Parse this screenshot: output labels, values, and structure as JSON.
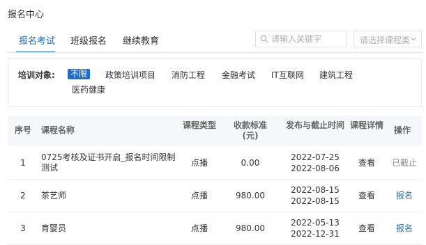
{
  "page_title": "报名中心",
  "tabs": [
    {
      "label": "报名考试",
      "active": true
    },
    {
      "label": "班级报名",
      "active": false
    },
    {
      "label": "继续教育",
      "active": false
    }
  ],
  "search": {
    "placeholder": "请输入关键字"
  },
  "course_type_select": {
    "placeholder": "请选择课程类"
  },
  "filter": {
    "label": "培训对象:",
    "options": [
      "不限",
      "政策培训项目",
      "消防工程",
      "金融考试",
      "IT互联网",
      "建筑工程",
      "医药健康"
    ],
    "selected": "不限"
  },
  "table": {
    "headers": {
      "index": "序号",
      "name": "课程名称",
      "type": "课程类型",
      "fee": "收款标准(元)",
      "dates": "发布与截止时间",
      "detail": "课程详情",
      "action": "操作"
    },
    "rows": [
      {
        "index": "1",
        "name": "0725考核及证书开启_报名时间限制测试",
        "type": "点播",
        "fee": "0.00",
        "publish": "2022-07-25",
        "deadline": "2022-08-06",
        "detail": "查看",
        "action": "已截止",
        "action_enabled": false
      },
      {
        "index": "2",
        "name": "茶艺师",
        "type": "点播",
        "fee": "980.00",
        "publish": "2022-08-15",
        "deadline": "2022-08-15",
        "detail": "查看",
        "action": "报名",
        "action_enabled": true
      },
      {
        "index": "3",
        "name": "育婴员",
        "type": "点播",
        "fee": "980.00",
        "publish": "2022-05-13",
        "deadline": "2022-12-31",
        "detail": "查看",
        "action": "报名",
        "action_enabled": true
      }
    ]
  },
  "colors": {
    "accent": "#1a6fd1",
    "header_bg": "#f5f7fa",
    "border": "#e4e7ed"
  },
  "icons": {
    "search": "search-icon",
    "select": "chevron-down-icon"
  }
}
